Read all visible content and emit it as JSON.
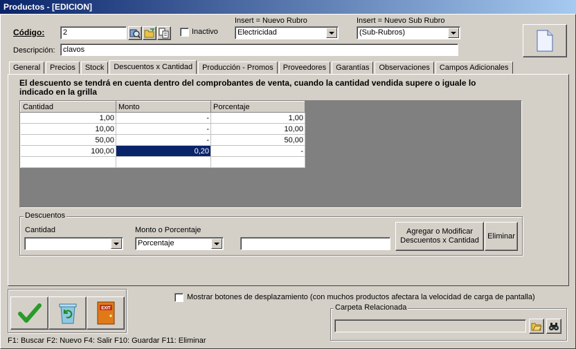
{
  "window": {
    "title": "Productos - [EDICION]"
  },
  "header": {
    "codigo_label": "Código:",
    "codigo_value": "2",
    "inactivo_label": "Inactivo",
    "rubro_label": "Insert = Nuevo Rubro",
    "rubro_value": "Electricidad",
    "subrubro_label": "Insert = Nuevo Sub Rubro",
    "subrubro_value": "(Sub-Rubros)",
    "descripcion_label": "Descripción:",
    "descripcion_value": "clavos"
  },
  "tabs": [
    {
      "label": "General"
    },
    {
      "label": "Precios"
    },
    {
      "label": "Stock"
    },
    {
      "label": "Descuentos x Cantidad"
    },
    {
      "label": "Producción - Promos"
    },
    {
      "label": "Proveedores"
    },
    {
      "label": "Garantías"
    },
    {
      "label": "Observaciones"
    },
    {
      "label": "Campos Adicionales"
    }
  ],
  "descuentos": {
    "info": "El descuento se tendrá en cuenta dentro del comprobantes de venta, cuando la cantidad vendida supere o iguale lo indicado en la grilla",
    "columns": [
      "Cantidad",
      "Monto",
      "Porcentaje"
    ],
    "rows": [
      [
        "1,00",
        "-",
        "1,00"
      ],
      [
        "10,00",
        "-",
        "10,00"
      ],
      [
        "50,00",
        "-",
        "50,00"
      ],
      [
        "100,00",
        "0,20",
        "-"
      ],
      [
        "",
        "",
        ""
      ]
    ],
    "group_label": "Descuentos",
    "cantidad_label": "Cantidad",
    "cantidad_value": "",
    "monto_label": "Monto o Porcentaje",
    "monto_value": "Porcentaje",
    "valor_value": "",
    "agregar_label": "Agregar o Modificar Descuentos x Cantidad",
    "eliminar_label": "Eliminar"
  },
  "footer": {
    "mostrar_label": "Mostrar botones de desplazamiento  (con muchos productos afectara la velocidad de carga de pantalla)",
    "carpeta_label": "Carpeta Relacionada",
    "carpeta_value": "",
    "shortcuts": "F1: Buscar  F2: Nuevo  F4: Salir  F10: Guardar  F11: Eliminar",
    "exit_text": "EXIT"
  },
  "colors": {
    "title_start": "#0a246a",
    "title_end": "#a6caf0",
    "selection": "#0a246a",
    "face": "#d4d0c8"
  }
}
